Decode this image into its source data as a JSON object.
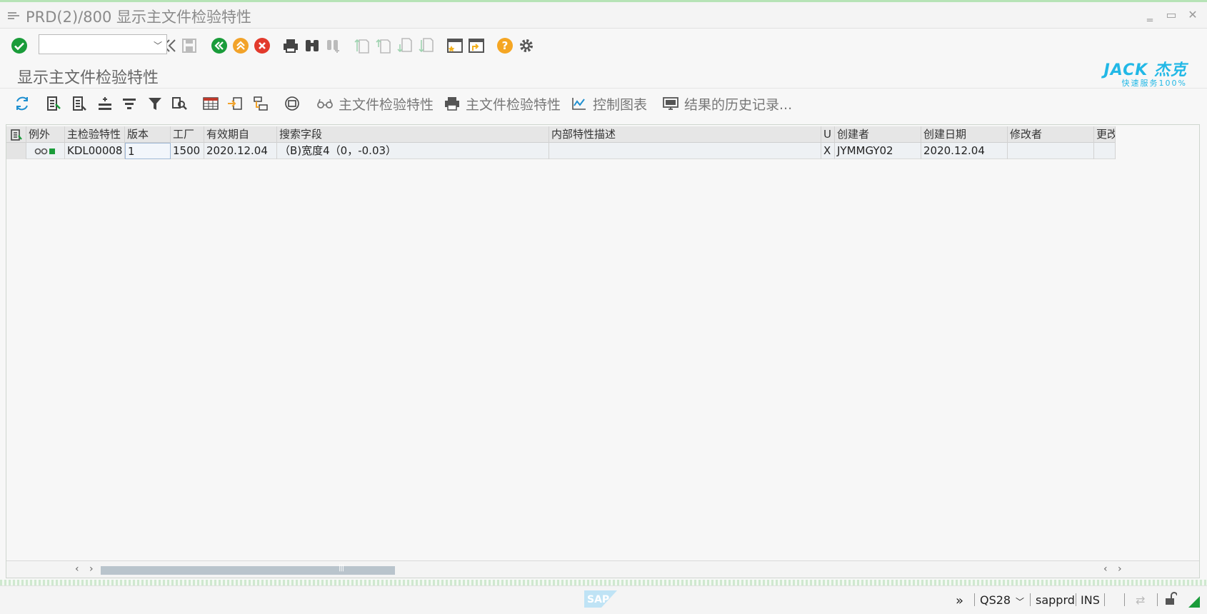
{
  "window": {
    "title": "PRD(2)/800 显示主文件检验特性"
  },
  "toolbar": {
    "command_field_value": "",
    "icons": [
      "enter-icon",
      "back-double-chevron-icon",
      "save-icon",
      "back-icon",
      "exit-icon",
      "cancel-icon",
      "print-icon",
      "find-icon",
      "find-next-icon",
      "first-page-icon",
      "previous-page-icon",
      "next-page-icon",
      "last-page-icon",
      "create-session-icon",
      "create-shortcut-icon",
      "help-icon",
      "settings-icon"
    ]
  },
  "screen": {
    "title": "显示主文件检验特性",
    "logo_brand": "JACK 杰克",
    "logo_slogan": "快速服务100%"
  },
  "app_toolbar": {
    "icons": [
      "refresh-icon",
      "details-icon",
      "choose-details-icon",
      "sort-icon",
      "filter-icon",
      "funnel-icon",
      "find-in-list-icon",
      "spreadsheet-icon",
      "export-icon",
      "layout-icon",
      "print-preview-icon"
    ],
    "btn_display": "主文件检验特性",
    "btn_print": "主文件检验特性",
    "btn_control_chart": "控制图表",
    "btn_result_history": "结果的历史记录..."
  },
  "grid": {
    "columns": [
      "例外",
      "主检验特性",
      "版本",
      "工厂",
      "有效期自",
      "搜索字段",
      "内部特性描述",
      "U",
      "创建者",
      "创建日期",
      "修改者",
      "更改"
    ],
    "rows": [
      {
        "exception": "traffic-light-green",
        "mic": "KDL00008",
        "version": "1",
        "plant": "1500",
        "valid_from": "2020.12.04",
        "search_field": "（B)宽度4（0，-0.03）",
        "internal_desc": "",
        "u": "X",
        "created_by": "JYMMGY02",
        "created_on": "2020.12.04",
        "changed_by": "",
        "changed": ""
      }
    ]
  },
  "statusbar": {
    "transaction": "QS28",
    "system": "sapprd",
    "mode": "INS"
  },
  "colors": {
    "enter_green": "#1a9c3a",
    "exit_orange": "#f2a32a",
    "cancel_red": "#e23a2c",
    "help_yellow": "#f5a623",
    "logo_blue": "#22b8e6",
    "status_green": "#1a9c3a"
  }
}
